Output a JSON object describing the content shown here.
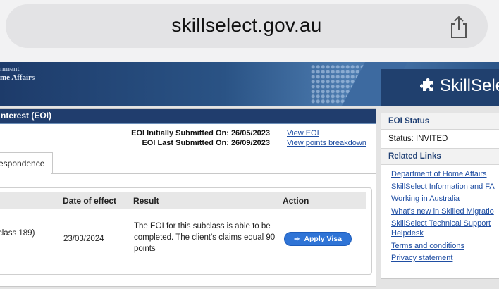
{
  "browser": {
    "url": "skillselect.gov.au"
  },
  "banner": {
    "gov_line1": "nment",
    "gov_line2": "me Affairs",
    "brand": "SkillSele"
  },
  "eoi": {
    "header": "nterest (EOI)",
    "initially_submitted": "EOI Initially Submitted On: 26/05/2023",
    "last_submitted": "EOI Last Submitted On: 26/09/2023",
    "link_view_eoi": "View EOI",
    "link_points": "View points breakdown",
    "tab_label": "espondence",
    "table": {
      "headers": {
        "date": "Date of effect",
        "result": "Result",
        "action": "Action"
      },
      "row": {
        "subclass": "class 189)",
        "date": "23/03/2024",
        "result": "The EOI for this subclass is able to be completed. The client's claims equal 90 points",
        "action": "Apply Visa"
      }
    }
  },
  "sidebar": {
    "status_title": "EOI Status",
    "status_text": "Status: INVITED",
    "links_title": "Related Links",
    "links": [
      "Department of Home Affairs",
      "SkillSelect Information and FA",
      "Working in Australia",
      "What's new in Skilled Migratio",
      "SkillSelect Technical Support",
      "Helpdesk",
      "Terms and conditions",
      "Privacy statement"
    ]
  },
  "colors": {
    "header_navy": "#203d6d",
    "link_blue": "#1f4ea3",
    "button_blue": "#2f74d6"
  }
}
